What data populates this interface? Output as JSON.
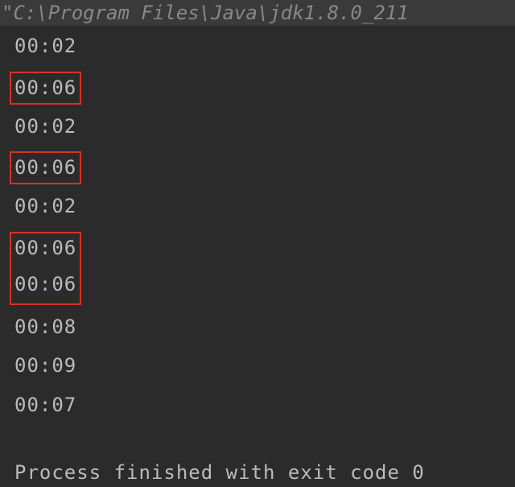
{
  "header": {
    "path": "\"C:\\Program Files\\Java\\jdk1.8.0_211"
  },
  "output": {
    "line1": "00:02",
    "line2": "00:06",
    "line3": "00:02",
    "line4": "00:06",
    "line5": "00:02",
    "line6": "00:06",
    "line7": "00:06",
    "line8": "00:08",
    "line9": "00:09",
    "line10": "00:07"
  },
  "status": {
    "message": "Process finished with exit code 0"
  },
  "highlight": {
    "color": "#d93025"
  }
}
